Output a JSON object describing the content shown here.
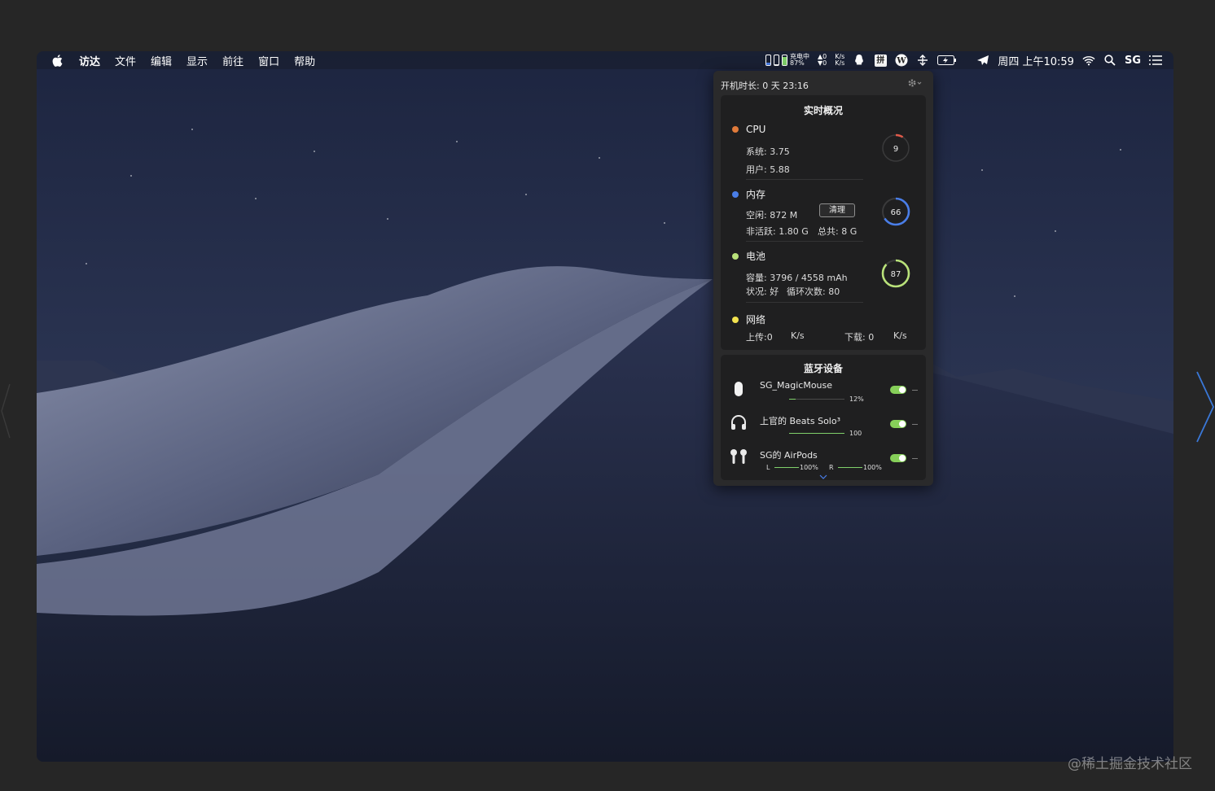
{
  "menubar": {
    "menus": [
      "访达",
      "文件",
      "编辑",
      "显示",
      "前往",
      "窗口",
      "帮助"
    ],
    "charging_label": "充电中",
    "battery_pct": "87%",
    "net_up": "0",
    "net_down": "0",
    "net_unit_top": "K/s",
    "net_unit_bottom": "K/s",
    "ime": "拼",
    "clock": "周四 上午10:59",
    "user": "SG",
    "icons": [
      "cpu-bar-icon",
      "mem-bar-icon",
      "battery-bar-icon",
      "qq-icon",
      "ime-icon",
      "wordpress-icon",
      "share-icon",
      "battery-charging-icon",
      "paper-plane-icon",
      "wifi-icon",
      "search-icon",
      "menu-list-icon"
    ]
  },
  "panel": {
    "uptime": "开机时长: 0 天 23:16",
    "realtime": {
      "title": "实时概况",
      "cpu": {
        "label": "CPU",
        "system": "系统: 3.75",
        "user": "用户: 5.88",
        "ring_value": "9",
        "ring_fraction": 0.09,
        "color": "#e07a3a"
      },
      "memory": {
        "label": "内存",
        "free": "空闲: 872  M",
        "clean_button": "清理",
        "inactive": "非活跃: 1.80    G",
        "total": "总共: 8 G",
        "ring_value": "66",
        "ring_fraction": 0.66,
        "color": "#4a7ee8"
      },
      "battery": {
        "label": "电池",
        "capacity": "容量: 3796 / 4558 mAh",
        "status": "状况: 好",
        "cycles": "循环次数: 80",
        "ring_value": "87",
        "ring_fraction": 0.87,
        "color": "#b9e27a"
      },
      "network": {
        "label": "网络",
        "upload": "上传:0",
        "upload_unit": "K/s",
        "download": "下载: 0",
        "download_unit": "K/s",
        "color": "#f2e24f"
      }
    },
    "bluetooth": {
      "title": "蓝牙设备",
      "devices": [
        {
          "name": "SG_MagicMouse",
          "pct": "12%",
          "level": 0.12,
          "icon": "mouse-icon"
        },
        {
          "name": "上官的 Beats Solo³",
          "pct": "100",
          "level": 1.0,
          "icon": "headphones-icon"
        },
        {
          "name": "SG的 AirPods",
          "left_label": "L",
          "left_pct": "100%",
          "left_level": 1.0,
          "right_label": "R",
          "right_pct": "100%",
          "right_level": 1.0,
          "icon": "airpods-icon"
        }
      ]
    }
  },
  "watermark": "@稀土掘金技术社区"
}
